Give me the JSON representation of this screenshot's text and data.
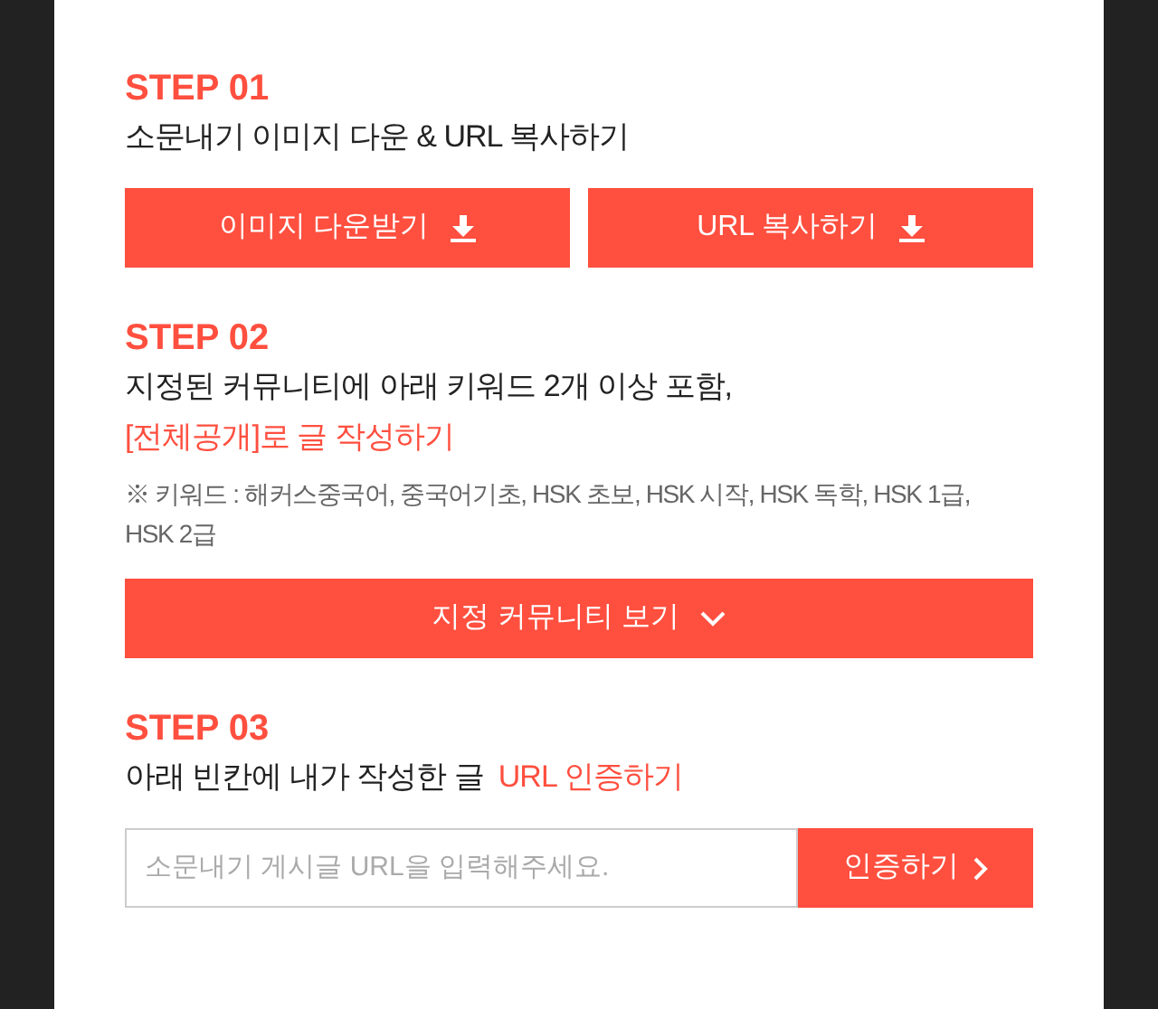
{
  "steps": [
    {
      "label": "STEP 01",
      "lines": [
        [
          {
            "text": "소문내기 이미지 다운 & URL 복사하기",
            "highlight": false
          }
        ]
      ],
      "buttons": [
        {
          "label": "이미지 다운받기",
          "kind": "download"
        },
        {
          "label": "URL 복사하기",
          "kind": "download"
        }
      ]
    },
    {
      "label": "STEP 02",
      "lines": [
        [
          {
            "text": "지정된 커뮤니티에 아래 키워드 2개 이상 포함,",
            "highlight": false
          }
        ],
        [
          {
            "text": "[전체공개]로 글 작성하기",
            "highlight": true
          }
        ]
      ],
      "note": "※ 키워드 : 해커스중국어, 중국어기초, HSK 초보, HSK 시작, HSK 독학, HSK 1급, HSK 2급",
      "buttons": [
        {
          "label": "지정 커뮤니티 보기",
          "kind": "expand"
        }
      ]
    },
    {
      "label": "STEP 03",
      "lines": [
        [
          {
            "text": "아래 빈칸에 내가 작성한 글",
            "highlight": false
          },
          {
            "text": "URL 인증하기",
            "highlight": true
          }
        ]
      ],
      "form": {
        "placeholder": "소문내기 게시글 URL을 입력해주세요.",
        "button": "인증하기"
      }
    }
  ]
}
